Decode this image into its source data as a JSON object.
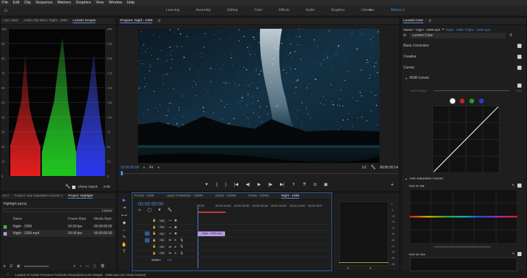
{
  "menu": [
    "File",
    "Edit",
    "Clip",
    "Sequence",
    "Markers",
    "Graphics",
    "View",
    "Window",
    "Help"
  ],
  "workspaces": [
    "Learning",
    "Assembly",
    "Editing",
    "Color",
    "Effects",
    "Audio",
    "Graphics",
    "Libraries",
    "Metrics 1"
  ],
  "active_workspace_index": 8,
  "scopes": {
    "tabs": [
      "r (no clips)",
      "Audio Clip Mixer: Night - 1099",
      "Lumetri Scopes"
    ],
    "y_labels": [
      "100",
      "90",
      "80",
      "70",
      "60",
      "50",
      "40",
      "30",
      "20",
      "10",
      "0"
    ],
    "y_labels_right": [
      "255",
      "230",
      "204",
      "178",
      "153",
      "128",
      "102",
      "76",
      "51",
      "25",
      "0"
    ],
    "clamp_label": "Clamp Signal",
    "bit_depth": "8 Bit"
  },
  "program": {
    "title": "Program: Night - 1099",
    "timecode_left": "00:00:00:00",
    "fit": "Fit",
    "zoom": "1/2",
    "timecode_right": "00:00:20:14"
  },
  "project": {
    "tabs": [
      "es 2",
      "Project: Hue Saturation Curves 1",
      "Project: Highlight"
    ],
    "file": "Highlight.prproj",
    "items_count": "2 Items",
    "columns": [
      "Name",
      "Frame Rate",
      "Media Start"
    ],
    "rows": [
      {
        "name": "Night - 1099",
        "fps": "24.00 fps",
        "start": "00:00:00:00",
        "color": "#3cb043"
      },
      {
        "name": "Night - 1099.mp4",
        "fps": "24.00 fps",
        "start": "00:00:00:00",
        "color": "#b49ae0"
      }
    ]
  },
  "timeline": {
    "tabs": [
      "Forest - 1099",
      "Upper Palatinate - 33506",
      "Dubai - 33956",
      "Pasta - 33935",
      "Night - 1099"
    ],
    "timecode": "00:00:00:00",
    "ruler": [
      "00:00",
      "00:00:15:00",
      "00:00:30:00",
      "00:00:45:00",
      "00:01:00:00",
      "00:01:15:00",
      "00:01:30:0"
    ],
    "video_tracks": [
      "V3",
      "V2",
      "V1"
    ],
    "audio_tracks": [
      "A1",
      "A2",
      "A3"
    ],
    "master": "Master",
    "master_value": "0.0",
    "clip_label": "Night - 1099.mp4"
  },
  "meter": {
    "labels": [
      "0",
      "-6",
      "-12",
      "-18",
      "-24",
      "-30",
      "-36",
      "-42",
      "-48",
      "-54",
      "-dB"
    ],
    "solo": [
      "S",
      "S"
    ]
  },
  "lumetri": {
    "title": "Lumetri Color",
    "master_path": "Master * Night - 1099.mp4",
    "clip_path": "Night - 1099 * Night - 1099.mp4",
    "fx_label": "fx",
    "effect_name": "Lumetri Color",
    "sections": [
      "Basic Correction",
      "Creative",
      "Curves"
    ],
    "rgb_curves": "RGB Curves",
    "hdr_range": "HDR Range",
    "hdr_max": "100",
    "hue_sat_curves": "Hue Saturation Curves",
    "hue_vs_sat": "Hue vs Sat",
    "hue_vs_hue": "Hue vs Hue",
    "channel_colors": [
      "#ffffff",
      "#cc1f1f",
      "#2a9a2a",
      "#2b3bd1"
    ]
  },
  "status": "Loaded D:\\Adobe Premiere Pro\\DVD 2\\Samples\\Lecke 3\\Night - 1099.mp4 (42 media loaded)",
  "colors": {
    "accent": "#4a8fe0",
    "clip_audio": "#b49ae0",
    "playhead": "#4a8fe0"
  }
}
